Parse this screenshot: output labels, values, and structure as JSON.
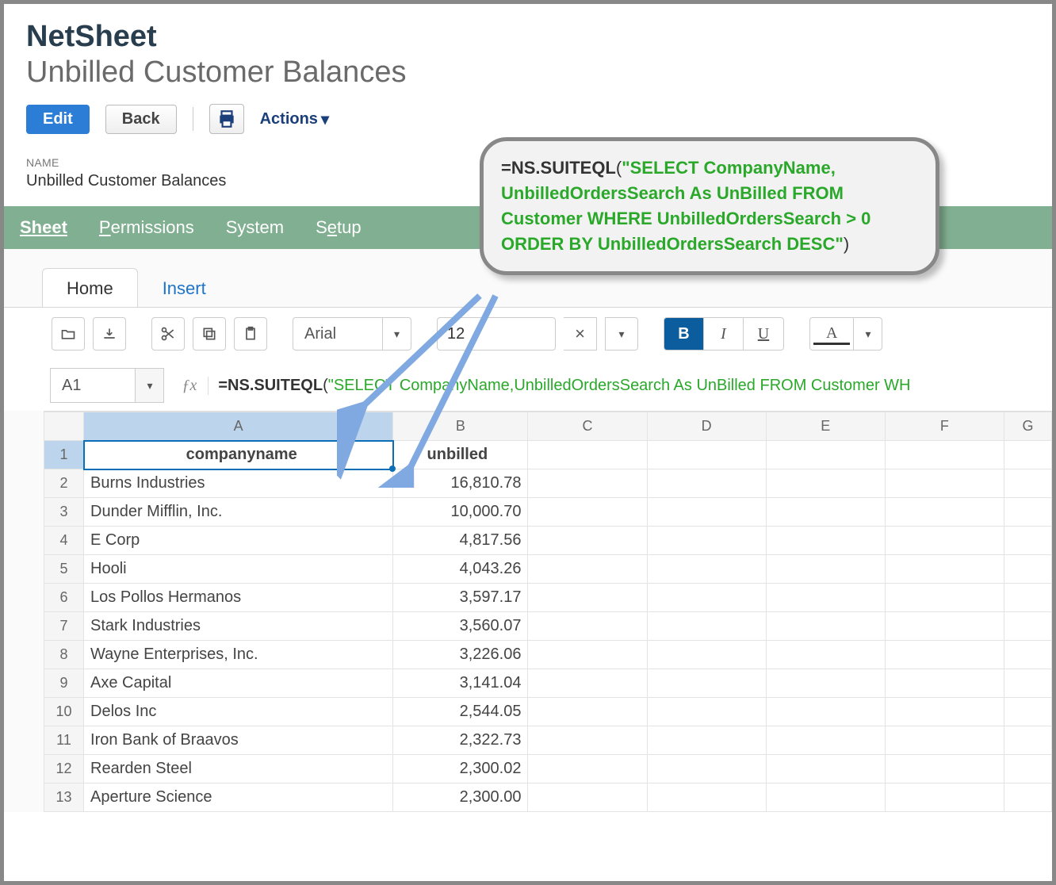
{
  "app_title": "NetSheet",
  "page_title": "Unbilled Customer Balances",
  "buttons": {
    "edit": "Edit",
    "back": "Back",
    "actions": "Actions"
  },
  "name_label": "NAME",
  "name_value": "Unbilled Customer Balances",
  "main_tabs": {
    "sheet": "Sheet",
    "permissions_pre": "P",
    "permissions_rest": "ermissions",
    "system": "System",
    "setup_pre": "S",
    "setup_mid": "e",
    "setup_rest": "tup"
  },
  "sheet_tabs": {
    "home": "Home",
    "insert": "Insert"
  },
  "toolbar": {
    "font": "Arial",
    "size": "12",
    "bold": "B",
    "italic": "I",
    "underline": "U",
    "fontcolor": "A",
    "clear": "×"
  },
  "cell_ref": "A1",
  "fx_label": "ƒx",
  "formula": {
    "eq": "=",
    "fn": "NS.SUITEQL",
    "open": "(",
    "str_bar": "\"SELECT CompanyName,UnbilledOrdersSearch As UnBilled FROM Customer WH",
    "callout_str": "\"SELECT CompanyName, UnbilledOrdersSearch As UnBilled FROM Customer WHERE  UnbilledOrdersSearch > 0 ORDER BY UnbilledOrdersSearch DESC\"",
    "close": ")"
  },
  "columns": [
    "A",
    "B",
    "C",
    "D",
    "E",
    "F",
    "G"
  ],
  "headers": {
    "a": "companyname",
    "b": "unbilled"
  },
  "rows": [
    {
      "n": 2,
      "a": "Burns Industries",
      "b": "16,810.78"
    },
    {
      "n": 3,
      "a": "Dunder Mifflin, Inc.",
      "b": "10,000.70"
    },
    {
      "n": 4,
      "a": "E Corp",
      "b": "4,817.56"
    },
    {
      "n": 5,
      "a": "Hooli",
      "b": "4,043.26"
    },
    {
      "n": 6,
      "a": "Los Pollos Hermanos",
      "b": "3,597.17"
    },
    {
      "n": 7,
      "a": "Stark Industries",
      "b": "3,560.07"
    },
    {
      "n": 8,
      "a": "Wayne Enterprises, Inc.",
      "b": "3,226.06"
    },
    {
      "n": 9,
      "a": "Axe Capital",
      "b": "3,141.04"
    },
    {
      "n": 10,
      "a": "Delos Inc",
      "b": "2,544.05"
    },
    {
      "n": 11,
      "a": "Iron Bank of Braavos",
      "b": "2,322.73"
    },
    {
      "n": 12,
      "a": "Rearden Steel",
      "b": "2,300.02"
    },
    {
      "n": 13,
      "a": "Aperture Science",
      "b": "2,300.00"
    }
  ]
}
